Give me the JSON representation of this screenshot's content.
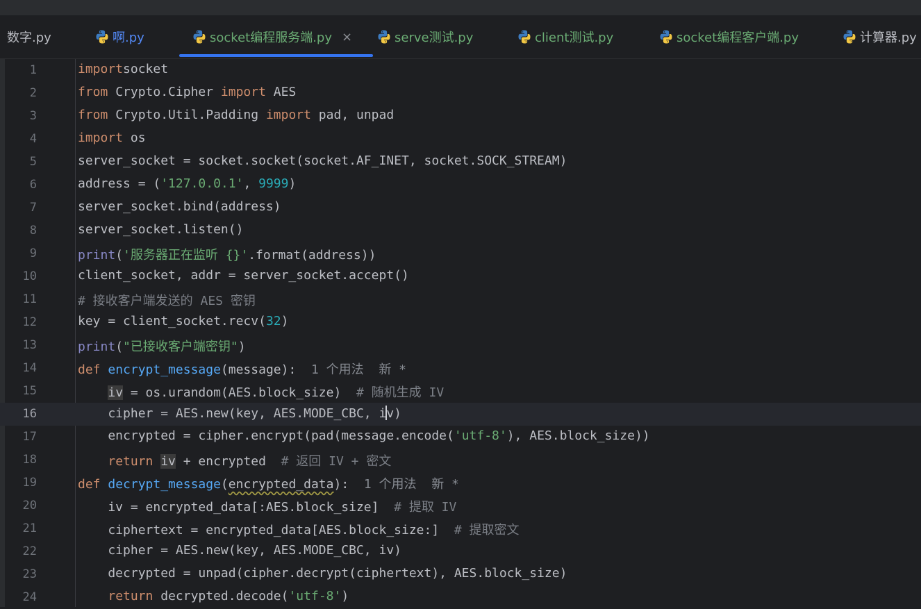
{
  "tabs": [
    {
      "label": "数字.py",
      "color": "#bcbec4",
      "icon": null,
      "active": false
    },
    {
      "label": "啊.py",
      "color": "#548af7",
      "icon": "python-file-icon",
      "active": false
    },
    {
      "label": "socket编程服务端.py",
      "color": "#6aab73",
      "icon": "python-file-icon",
      "active": true,
      "close": "×"
    },
    {
      "label": "serve测试.py",
      "color": "#6aab73",
      "icon": "python-file-icon",
      "active": false
    },
    {
      "label": "client测试.py",
      "color": "#6aab73",
      "icon": "python-file-icon",
      "active": false
    },
    {
      "label": "socket编程客户端.py",
      "color": "#6aab73",
      "icon": "python-file-icon",
      "active": false
    },
    {
      "label": "计算器.py",
      "color": "#bcbec4",
      "icon": "python-file-icon",
      "active": false
    }
  ],
  "editor": {
    "current_line": 16,
    "lines": [
      {
        "n": "1",
        "tokens": [
          [
            "kw",
            "import"
          ],
          [
            "",
            "socket"
          ]
        ]
      },
      {
        "n": "2",
        "tokens": [
          [
            "kw",
            "from"
          ],
          [
            "",
            " Crypto.Cipher "
          ],
          [
            "kw",
            "import"
          ],
          [
            "",
            " AES"
          ]
        ]
      },
      {
        "n": "3",
        "tokens": [
          [
            "kw",
            "from"
          ],
          [
            "",
            " Crypto.Util.Padding "
          ],
          [
            "kw",
            "import"
          ],
          [
            "",
            " pad, unpad"
          ]
        ]
      },
      {
        "n": "4",
        "tokens": [
          [
            "kw",
            "import"
          ],
          [
            "",
            " os"
          ]
        ]
      },
      {
        "n": "5",
        "tokens": [
          [
            "",
            "server_socket = socket.socket(socket.AF_INET, socket.SOCK_STREAM)"
          ]
        ]
      },
      {
        "n": "6",
        "tokens": [
          [
            "",
            "address = ("
          ],
          [
            "str",
            "'127.0.0.1'"
          ],
          [
            "",
            ", "
          ],
          [
            "num",
            "9999"
          ],
          [
            "",
            ")"
          ]
        ]
      },
      {
        "n": "7",
        "tokens": [
          [
            "",
            "server_socket.bind(address)"
          ]
        ]
      },
      {
        "n": "8",
        "tokens": [
          [
            "",
            "server_socket.listen()"
          ]
        ]
      },
      {
        "n": "9",
        "tokens": [
          [
            "bi",
            "print"
          ],
          [
            "",
            "("
          ],
          [
            "str",
            "'服务器正在监听 {}'"
          ],
          [
            "",
            ".format(address))"
          ]
        ]
      },
      {
        "n": "10",
        "tokens": [
          [
            "",
            "client_socket, addr = server_socket.accept()"
          ]
        ]
      },
      {
        "n": "11",
        "tokens": [
          [
            "cm",
            "# 接收客户端发送的 AES 密钥"
          ]
        ]
      },
      {
        "n": "12",
        "tokens": [
          [
            "",
            "key = client_socket.recv("
          ],
          [
            "num",
            "32"
          ],
          [
            "",
            ")"
          ]
        ]
      },
      {
        "n": "13",
        "tokens": [
          [
            "bi",
            "print"
          ],
          [
            "",
            "("
          ],
          [
            "str",
            "\"已接收客户端密钥\""
          ],
          [
            "",
            ")"
          ]
        ]
      },
      {
        "n": "14",
        "tokens": [
          [
            "kw",
            "def "
          ],
          [
            "fn",
            "encrypt_message"
          ],
          [
            "",
            "(message):  "
          ],
          [
            "hint",
            "1 个用法  新 *"
          ]
        ]
      },
      {
        "n": "15",
        "tokens": [
          [
            "",
            "    "
          ],
          [
            "hl",
            "iv"
          ],
          [
            "",
            " = os.urandom(AES.block_size)  "
          ],
          [
            "cm",
            "# 随机生成 IV"
          ]
        ]
      },
      {
        "n": "16",
        "tokens": [
          [
            "",
            "    cipher = AES.new(key, AES.MODE_CBC, i"
          ],
          [
            "caret",
            ""
          ],
          [
            "",
            "v)"
          ]
        ]
      },
      {
        "n": "17",
        "tokens": [
          [
            "",
            "    encrypted = cipher.encrypt(pad(message.encode("
          ],
          [
            "str",
            "'utf-8'"
          ],
          [
            "",
            "), AES.block_size))"
          ]
        ]
      },
      {
        "n": "18",
        "tokens": [
          [
            "",
            "    "
          ],
          [
            "kw",
            "return "
          ],
          [
            "hl",
            "iv"
          ],
          [
            "",
            " + encrypted  "
          ],
          [
            "cm",
            "# 返回 IV + 密文"
          ]
        ]
      },
      {
        "n": "19",
        "tokens": [
          [
            "kw",
            "def "
          ],
          [
            "fn",
            "decrypt_message"
          ],
          [
            "",
            "("
          ],
          [
            "sq",
            "encrypted_data"
          ],
          [
            "",
            "):  "
          ],
          [
            "hint",
            "1 个用法  新 *"
          ]
        ]
      },
      {
        "n": "20",
        "tokens": [
          [
            "",
            "    iv = encrypted_data[:AES.block_size]  "
          ],
          [
            "cm",
            "# 提取 IV"
          ]
        ]
      },
      {
        "n": "21",
        "tokens": [
          [
            "",
            "    ciphertext = encrypted_data[AES.block_size:]  "
          ],
          [
            "cm",
            "# 提取密文"
          ]
        ]
      },
      {
        "n": "22",
        "tokens": [
          [
            "",
            "    cipher = AES.new(key, AES.MODE_CBC, iv)"
          ]
        ]
      },
      {
        "n": "23",
        "tokens": [
          [
            "",
            "    decrypted = unpad(cipher.decrypt(ciphertext), AES.block_size)"
          ]
        ]
      },
      {
        "n": "24",
        "tokens": [
          [
            "",
            "    "
          ],
          [
            "kw",
            "return"
          ],
          [
            "",
            " decrypted.decode("
          ],
          [
            "str",
            "'utf-8'"
          ],
          [
            "",
            ")"
          ]
        ]
      }
    ]
  }
}
